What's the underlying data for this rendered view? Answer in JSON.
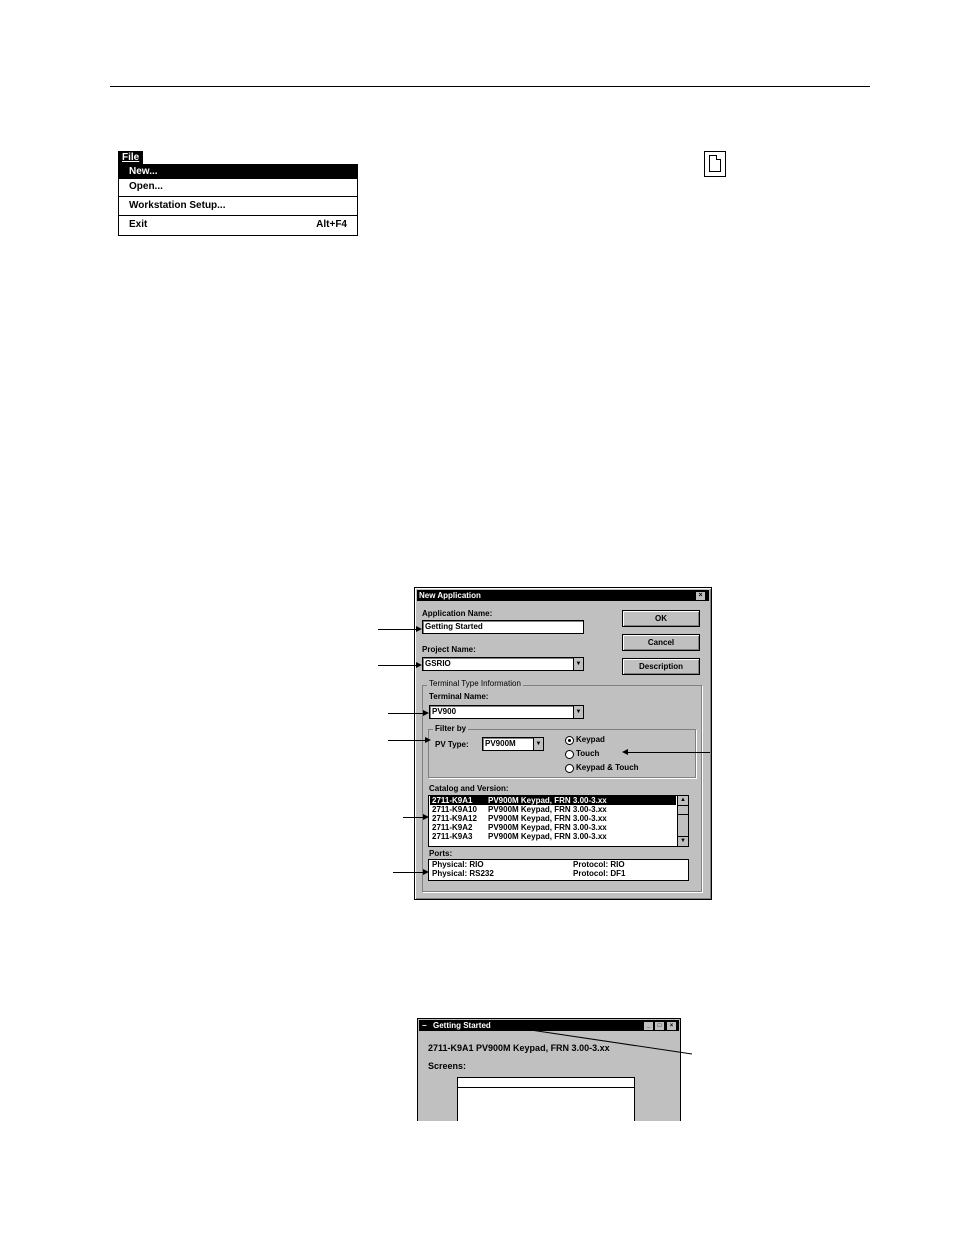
{
  "file_menu": {
    "title": "File",
    "items": [
      {
        "label": "New...",
        "shortcut": "",
        "selected": true
      },
      {
        "label": "Open...",
        "shortcut": "",
        "selected": false
      },
      {
        "label": "Workstation Setup...",
        "shortcut": "",
        "selected": false
      },
      {
        "label": "Exit",
        "shortcut": "Alt+F4",
        "selected": false
      }
    ]
  },
  "toolbar_icon": "new-document-icon",
  "dialog": {
    "title": "New Application",
    "close_glyph": "×",
    "application_name_label": "Application Name:",
    "application_name_value": "Getting Started",
    "project_name_label": "Project Name:",
    "project_name_value": "GSRIO",
    "buttons": {
      "ok": "OK",
      "cancel": "Cancel",
      "description": "Description"
    },
    "terminal_group_label": "Terminal Type Information",
    "terminal_name_label": "Terminal Name:",
    "terminal_name_value": "PV900",
    "filter_by_label": "Filter by",
    "pv_type_label": "PV Type:",
    "pv_type_value": "PV900M",
    "radios": [
      {
        "label": "Keypad",
        "checked": true
      },
      {
        "label": "Touch",
        "checked": false
      },
      {
        "label": "Keypad & Touch",
        "checked": false
      }
    ],
    "catalog_label": "Catalog and Version:",
    "catalog_rows": [
      {
        "catalog": "2711-K9A1",
        "desc": "PV900M Keypad, FRN 3.00-3.xx",
        "selected": true
      },
      {
        "catalog": "2711-K9A10",
        "desc": "PV900M Keypad, FRN 3.00-3.xx",
        "selected": false
      },
      {
        "catalog": "2711-K9A12",
        "desc": "PV900M Keypad, FRN 3.00-3.xx",
        "selected": false
      },
      {
        "catalog": "2711-K9A2",
        "desc": "PV900M Keypad, FRN 3.00-3.xx",
        "selected": false
      },
      {
        "catalog": "2711-K9A3",
        "desc": "PV900M Keypad, FRN 3.00-3.xx",
        "selected": false
      }
    ],
    "ports_label": "Ports:",
    "ports": [
      {
        "physical": "Physical: RIO",
        "protocol": "Protocol: RIO"
      },
      {
        "physical": "Physical: RS232",
        "protocol": "Protocol: DF1"
      }
    ],
    "dropdown_glyph": "▼",
    "scroll_up_glyph": "▲",
    "scroll_down_glyph": "▼"
  },
  "app_window": {
    "title": "Getting Started",
    "system_glyph": "−",
    "min_glyph": "_",
    "max_glyph": "□",
    "close_glyph": "×",
    "catalog_line": "2711-K9A1    PV900M Keypad, FRN 3.00-3.xx",
    "screens_label": "Screens:"
  }
}
